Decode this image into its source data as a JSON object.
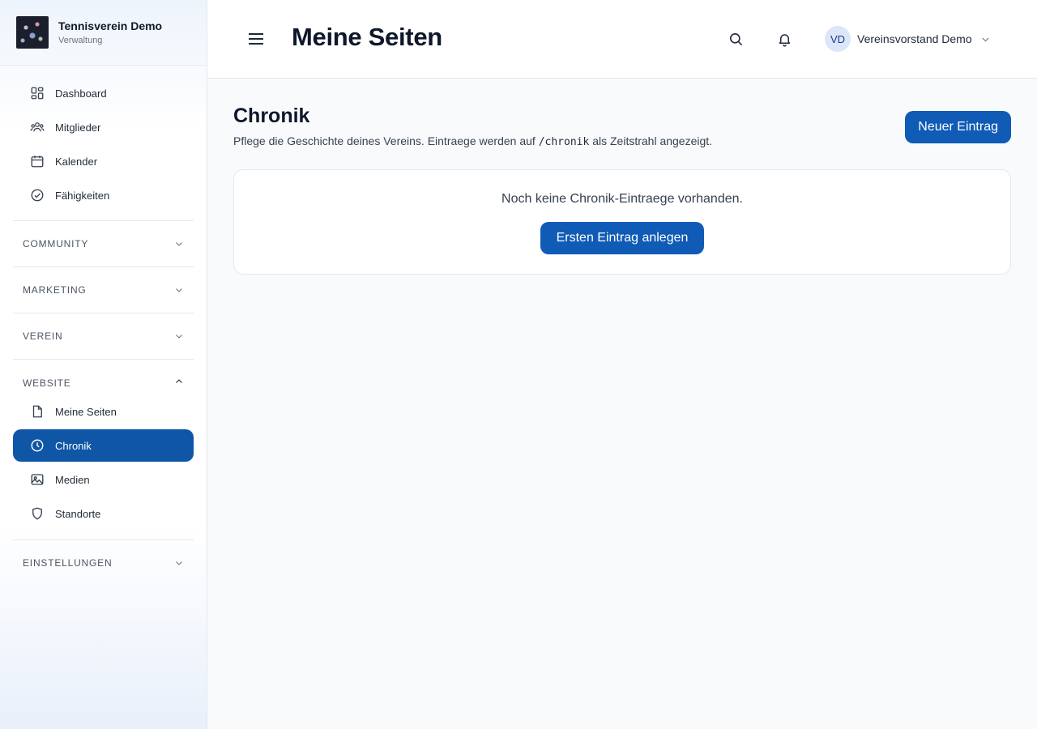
{
  "brand": {
    "name": "Tennisverein Demo",
    "subtitle": "Verwaltung"
  },
  "sidebar": {
    "main_items": [
      {
        "label": "Dashboard",
        "icon": "dashboard-icon"
      },
      {
        "label": "Mitglieder",
        "icon": "users-icon"
      },
      {
        "label": "Kalender",
        "icon": "calendar-icon"
      },
      {
        "label": "Fähigkeiten",
        "icon": "check-circle-icon"
      }
    ],
    "sections": [
      {
        "title": "COMMUNITY",
        "expanded": false
      },
      {
        "title": "MARKETING",
        "expanded": false
      },
      {
        "title": "VEREIN",
        "expanded": false
      },
      {
        "title": "WEBSITE",
        "expanded": true
      },
      {
        "title": "EINSTELLUNGEN",
        "expanded": false
      }
    ],
    "website_items": [
      {
        "label": "Meine Seiten",
        "icon": "page-icon"
      },
      {
        "label": "Chronik",
        "icon": "clock-icon",
        "active": true
      },
      {
        "label": "Medien",
        "icon": "image-icon"
      },
      {
        "label": "Standorte",
        "icon": "location-icon"
      }
    ]
  },
  "header": {
    "title": "Meine Seiten",
    "user": {
      "initials": "VD",
      "name": "Vereinsvorstand Demo"
    }
  },
  "main": {
    "title": "Chronik",
    "description_prefix": "Pflege die Geschichte deines Vereins. Eintraege werden auf",
    "description_code": "/chronik",
    "description_suffix": "als Zeitstrahl angezeigt.",
    "new_button": "Neuer Eintrag",
    "empty_text": "Noch keine Chronik-Eintraege vorhanden.",
    "first_button": "Ersten Eintrag anlegen"
  },
  "colors": {
    "accent": "#0f5bb5",
    "active_nav": "#0f56a6",
    "text": "#1f2937"
  }
}
